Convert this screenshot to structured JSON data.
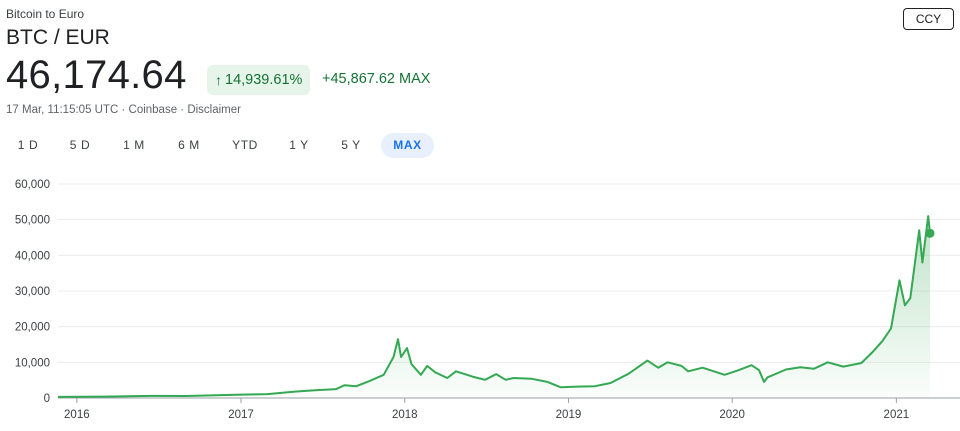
{
  "header": {
    "subtitle": "Bitcoin to Euro",
    "pair": "BTC / EUR",
    "ccy_button": "CCY",
    "price": "46,174.64",
    "change_pct": "14,939.61%",
    "change_arrow_icon": "arrow-up-icon",
    "change_abs": "+45,867.62",
    "change_period": "MAX",
    "meta": "17 Mar, 11:15:05 UTC · Coinbase · Disclaimer"
  },
  "tabs": [
    {
      "label": "1 D"
    },
    {
      "label": "5 D"
    },
    {
      "label": "1 M"
    },
    {
      "label": "6 M"
    },
    {
      "label": "YTD"
    },
    {
      "label": "1 Y"
    },
    {
      "label": "5 Y"
    },
    {
      "label": "MAX",
      "active": true
    }
  ],
  "colors": {
    "line": "#34a853",
    "positive_text": "#137333",
    "positive_bg": "#e6f4ea",
    "active_tab_bg": "#e8f0fe",
    "active_tab_text": "#1a73e8"
  },
  "chart_data": {
    "type": "area",
    "ylim": [
      0,
      60000
    ],
    "y_ticks": [
      0,
      10000,
      20000,
      30000,
      40000,
      50000,
      60000
    ],
    "y_tick_labels": [
      "0",
      "10,000",
      "20,000",
      "30,000",
      "40,000",
      "50,000",
      "60,000"
    ],
    "x_ticks": [
      "2016",
      "2017",
      "2018",
      "2019",
      "2020",
      "2021"
    ],
    "xlim": [
      "2015-11-20",
      "2021-03-17"
    ],
    "grid": "horizontal",
    "series": [
      {
        "x": [
          "2015-11-20",
          "2016-03-01",
          "2016-06-20",
          "2016-09-01",
          "2016-12-20",
          "2017-03-01",
          "2017-05-01",
          "2017-06-15",
          "2017-08-01",
          "2017-08-20",
          "2017-09-15",
          "2017-10-15",
          "2017-11-15",
          "2017-12-07",
          "2017-12-17",
          "2017-12-24",
          "2018-01-06",
          "2018-01-16",
          "2018-02-06",
          "2018-02-20",
          "2018-03-10",
          "2018-04-06",
          "2018-04-25",
          "2018-06-01",
          "2018-06-29",
          "2018-07-24",
          "2018-08-14",
          "2018-09-01",
          "2018-10-10",
          "2018-11-15",
          "2018-12-15",
          "2019-01-20",
          "2019-03-01",
          "2019-04-05",
          "2019-05-15",
          "2019-06-26",
          "2019-07-20",
          "2019-08-10",
          "2019-09-10",
          "2019-09-25",
          "2019-10-27",
          "2019-12-15",
          "2020-01-15",
          "2020-02-13",
          "2020-03-01",
          "2020-03-12",
          "2020-03-20",
          "2020-04-30",
          "2020-06-01",
          "2020-07-01",
          "2020-08-01",
          "2020-09-05",
          "2020-10-15",
          "2020-11-10",
          "2020-12-01",
          "2020-12-20",
          "2021-01-08",
          "2021-01-20",
          "2021-02-01",
          "2021-02-21",
          "2021-02-28",
          "2021-03-13",
          "2021-03-17"
        ],
        "y": [
          300,
          380,
          600,
          550,
          900,
          1100,
          1800,
          2200,
          2500,
          3600,
          3300,
          4800,
          6500,
          11500,
          16500,
          11500,
          14000,
          9500,
          6500,
          9000,
          7200,
          5600,
          7500,
          6000,
          5100,
          6700,
          5100,
          5600,
          5400,
          4500,
          3000,
          3200,
          3300,
          4200,
          6800,
          10500,
          8500,
          10000,
          9000,
          7500,
          8500,
          6500,
          7800,
          9200,
          7800,
          4500,
          5800,
          8000,
          8600,
          8200,
          10000,
          8800,
          9800,
          13000,
          16000,
          19500,
          33000,
          26000,
          28000,
          47000,
          38000,
          51000,
          46175
        ]
      }
    ]
  }
}
